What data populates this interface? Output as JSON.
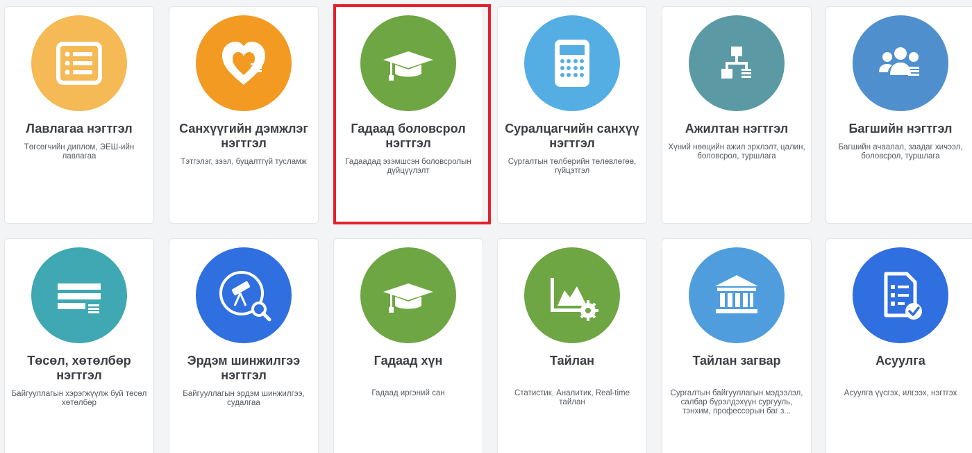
{
  "modules": [
    {
      "id": "lavlagaa",
      "icon": "list-icon",
      "color": "#f5b955",
      "title": "Лавлагаа нэгтгэл",
      "description": "Төгсөгчийн диплом, ЭЕШ-ийн лавлагаа"
    },
    {
      "id": "sankhuu-demjleg",
      "icon": "heart-hand-icon",
      "color": "#f29a21",
      "title": "Санхүүгийн дэмжлэг нэгтгэл",
      "description": "Тэтгэлэг, зээл, буцалтгүй тусламж"
    },
    {
      "id": "gadaad-bolovsrol",
      "icon": "graduation-cap-icon",
      "color": "#6ea643",
      "title": "Гадаад боловсрол нэгтгэл",
      "description": "Гадаадад эзэмшсэн боловсролын дүйцүүлэлт"
    },
    {
      "id": "suralcagch-sankhuu",
      "icon": "calculator-icon",
      "color": "#55aee3",
      "title": "Суралцагчийн санхүү нэгтгэл",
      "description": "Сургалтын төлбөрийн төлөвлөгөө, гүйцэтгэл"
    },
    {
      "id": "ajiltan",
      "icon": "org-chart-icon",
      "color": "#5b9aa5",
      "title": "Ажилтан нэгтгэл",
      "description": "Хүний нөөцийн ажил эрхлэлт, цалин, боловсрол, туршлага"
    },
    {
      "id": "bagsh",
      "icon": "people-group-icon",
      "color": "#4f8fce",
      "title": "Багшийн нэгтгэл",
      "description": "Багшийн ачаалал, заадаг хичээл, боловсрол, туршлага"
    },
    {
      "id": "tosol",
      "icon": "project-list-icon",
      "color": "#3fa8b2",
      "title": "Төсөл, хөтөлбөр нэгтгэл",
      "description": "Байгууллагын хэрэгжүүлж буй төсөл хөтөлбөр"
    },
    {
      "id": "erdem",
      "icon": "telescope-search-icon",
      "color": "#2f6fe0",
      "title": "Эрдэм шинжилгээ нэгтгэл",
      "description": "Байгууллагын эрдэм шинжилгээ, судалгаа"
    },
    {
      "id": "gadaad-hun",
      "icon": "graduation-cap-icon",
      "color": "#6ea643",
      "title": "Гадаад хүн",
      "description": "Гадаад иргэний сан"
    },
    {
      "id": "tailan",
      "icon": "chart-gear-icon",
      "color": "#6ea643",
      "title": "Тайлан",
      "description": "Статистик, Аналитик, Real-time тайлан"
    },
    {
      "id": "tailan-zagvar",
      "icon": "institution-building-icon",
      "color": "#4f9ddc",
      "title": "Тайлан загвар",
      "description": "Сургалтын байгууллагын мэдээлэл, салбар бүрэлдэхүүн сургууль, тэнхим, профессорын баг з..."
    },
    {
      "id": "asuulga",
      "icon": "checklist-icon",
      "color": "#2f6fe0",
      "title": "Асуулга",
      "description": "Асуулга үүсгэх, илгээх, нэгтгэх"
    }
  ],
  "highlight_color": "#e3212b"
}
